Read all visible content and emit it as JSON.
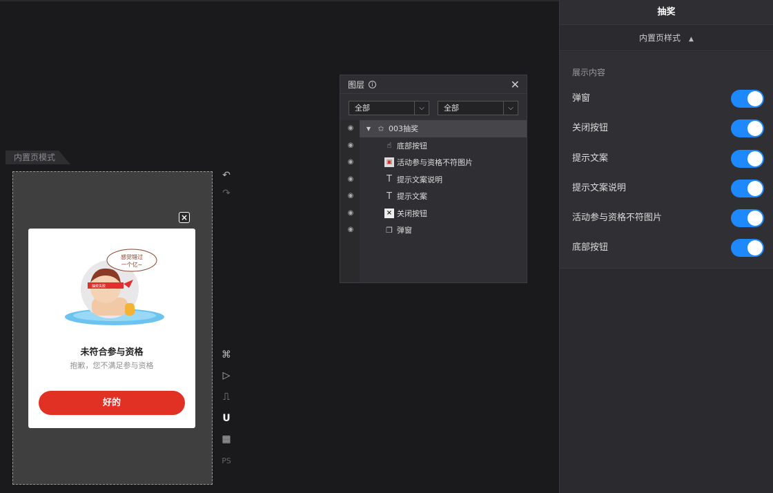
{
  "canvas": {
    "mode_tab": "内置页模式",
    "popup": {
      "speech_bubble": "感觉错过\n一个亿~",
      "headband_text": "抽奖失败",
      "title": "未符合参与资格",
      "subtitle": "抱歉，您不满足参与资格",
      "button_label": "好的"
    },
    "tools": [
      "command-icon",
      "play-icon",
      "paint-roller-icon",
      "magnet-icon",
      "grid-icon",
      "ps-icon"
    ],
    "ps_label": "PS"
  },
  "layers_panel": {
    "title": "图层",
    "filter_left": "全部",
    "filter_right": "全部",
    "root": "003抽奖",
    "items": [
      {
        "label": "底部按钮",
        "icon": "pointer-icon"
      },
      {
        "label": "活动参与资格不符图片",
        "icon": "image-icon"
      },
      {
        "label": "提示文案说明",
        "icon": "text-icon"
      },
      {
        "label": "提示文案",
        "icon": "text-icon"
      },
      {
        "label": "关闭按钮",
        "icon": "close-box-icon"
      },
      {
        "label": "弹窗",
        "icon": "window-icon"
      }
    ]
  },
  "right_panel": {
    "title": "抽奖",
    "section": "内置页样式",
    "content_label": "展示内容",
    "toggles": [
      {
        "label": "弹窗",
        "on": true
      },
      {
        "label": "关闭按钮",
        "on": true
      },
      {
        "label": "提示文案",
        "on": true
      },
      {
        "label": "提示文案说明",
        "on": true
      },
      {
        "label": "活动参与资格不符图片",
        "on": true
      },
      {
        "label": "底部按钮",
        "on": true
      }
    ],
    "accent": "#1e88ff"
  }
}
